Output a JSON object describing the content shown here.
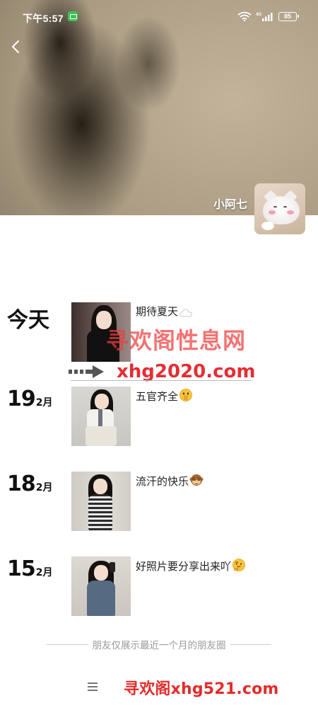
{
  "status_bar": {
    "time": "下午5:57",
    "battery": "85",
    "network": "4G"
  },
  "profile": {
    "name": "小阿七"
  },
  "posts": [
    {
      "day": "今天",
      "month": "",
      "text": "期待夏天",
      "emoji": "cloud-icon"
    },
    {
      "day": "19",
      "month": "2月",
      "text": "五官齐全",
      "emoji": "face-shushing-icon"
    },
    {
      "day": "18",
      "month": "2月",
      "text": "流汗的快乐",
      "emoji": "see-no-evil-monkey-icon"
    },
    {
      "day": "15",
      "month": "2月",
      "text": "好照片要分享出来吖",
      "emoji": "thinking-face-icon"
    }
  ],
  "watermark": {
    "site_name": "寻欢阁性息网",
    "url": "xhg2020.com",
    "bottom": "寻欢阁xhg521.com"
  },
  "footer": {
    "note": "朋友仅展示最近一个月的朋友圈"
  },
  "colors": {
    "watermark_red": "#e52a2a",
    "muted_text": "#9a9a9a"
  }
}
